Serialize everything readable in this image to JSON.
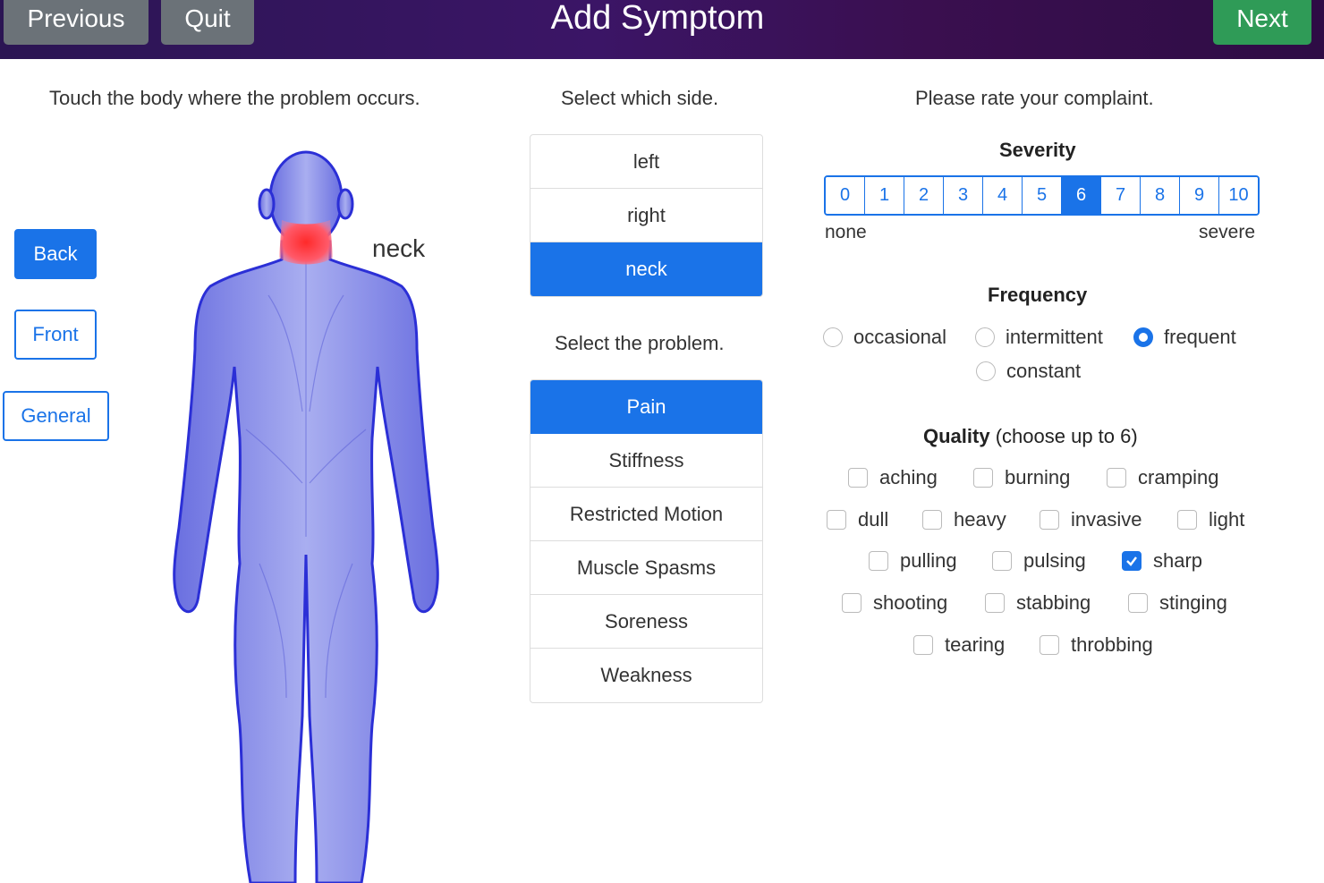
{
  "header": {
    "title": "Add Symptom",
    "previous_label": "Previous",
    "quit_label": "Quit",
    "next_label": "Next"
  },
  "body_column": {
    "instruction": "Touch the body where the problem occurs.",
    "view_buttons": [
      {
        "label": "Back",
        "active": true
      },
      {
        "label": "Front",
        "active": false
      },
      {
        "label": "General",
        "active": false
      }
    ],
    "selected_region_label": "neck"
  },
  "side_column": {
    "instruction": "Select which side.",
    "options": [
      {
        "label": "left",
        "active": false
      },
      {
        "label": "right",
        "active": false
      },
      {
        "label": "neck",
        "active": true
      }
    ],
    "problem_instruction": "Select the problem.",
    "problems": [
      {
        "label": "Pain",
        "active": true
      },
      {
        "label": "Stiffness",
        "active": false
      },
      {
        "label": "Restricted Motion",
        "active": false
      },
      {
        "label": "Muscle Spasms",
        "active": false
      },
      {
        "label": "Soreness",
        "active": false
      },
      {
        "label": "Weakness",
        "active": false
      }
    ]
  },
  "rating_column": {
    "instruction": "Please rate your complaint.",
    "severity": {
      "title": "Severity",
      "scale": [
        "0",
        "1",
        "2",
        "3",
        "4",
        "5",
        "6",
        "7",
        "8",
        "9",
        "10"
      ],
      "selected": "6",
      "min_label": "none",
      "max_label": "severe"
    },
    "frequency": {
      "title": "Frequency",
      "options": [
        "occasional",
        "intermittent",
        "frequent",
        "constant"
      ],
      "selected": "frequent"
    },
    "quality": {
      "title": "Quality",
      "subtitle": "(choose up to 6)",
      "options": [
        "aching",
        "burning",
        "cramping",
        "dull",
        "heavy",
        "invasive",
        "light",
        "pulling",
        "pulsing",
        "sharp",
        "shooting",
        "stabbing",
        "stinging",
        "tearing",
        "throbbing"
      ],
      "checked": [
        "sharp"
      ]
    }
  },
  "colors": {
    "accent": "#1a73e8",
    "header_gradient_start": "#2b1553",
    "header_gradient_end": "#2e0c45",
    "next_button": "#2f9b57",
    "gray_button": "#6b7278",
    "highlight": "#ff3b3b",
    "body_tint": "#7f86e6"
  }
}
